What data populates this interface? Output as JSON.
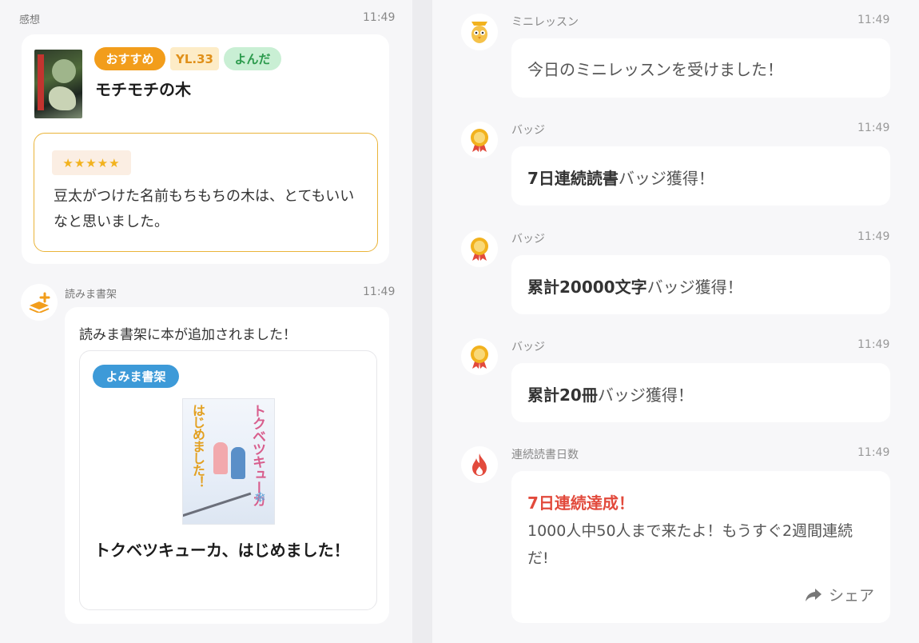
{
  "left": {
    "review": {
      "category": "感想",
      "time": "11:49",
      "tags": {
        "recommend": "おすすめ",
        "yl": "YL.33",
        "read": "よんだ"
      },
      "book_title": "モチモチの木",
      "stars": "★★★★★",
      "rating": 5,
      "review_text": "豆太がつけた名前もちもちの木は、とてもいいなと思いました。"
    },
    "shelf": {
      "category": "読みま書架",
      "time": "11:49",
      "message": "読みま書架に本が追加されました！",
      "tag": "よみま書架",
      "book_title": "トクベツキューカ、はじめました！",
      "cover_title": "トクベツキューカ",
      "cover_subtitle": "はじめました！"
    }
  },
  "right": {
    "items": [
      {
        "category": "ミニレッスン",
        "time": "11:49",
        "text": "今日のミニレッスンを受けました！",
        "bold": ""
      },
      {
        "category": "バッジ",
        "time": "11:49",
        "bold": "7日連続読書",
        "text": "バッジ獲得！"
      },
      {
        "category": "バッジ",
        "time": "11:49",
        "bold": "累計20000文字",
        "text": "バッジ獲得！"
      },
      {
        "category": "バッジ",
        "time": "11:49",
        "bold": "累計20冊",
        "text": "バッジ獲得！"
      }
    ],
    "streak": {
      "category": "連続読書日数",
      "time": "11:49",
      "title": "7日連続達成！",
      "body": "1000人中50人まで来たよ！もうすぐ2週間連続だ!",
      "share_label": "シェア"
    }
  },
  "colors": {
    "orange": "#f29d1b",
    "blue": "#3d9ad8",
    "green_bg": "#c9efd4",
    "streak_red": "#e24a3c"
  }
}
